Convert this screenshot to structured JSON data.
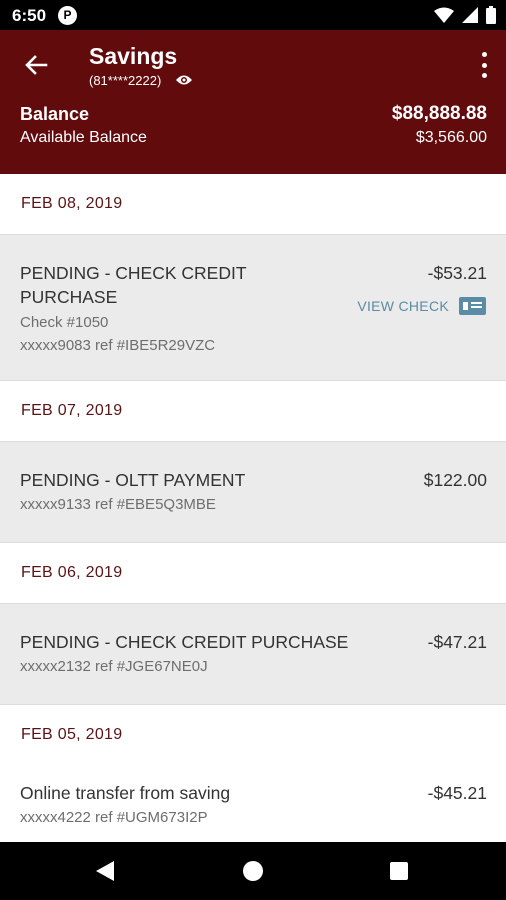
{
  "status_bar": {
    "time": "6:50",
    "app_badge": "P"
  },
  "header": {
    "title": "Savings",
    "account_number": "(81****2222)",
    "balance_label": "Balance",
    "balance_value": "$88,888.88",
    "available_label": "Available Balance",
    "available_value": "$3,566.00"
  },
  "groups": [
    {
      "date": "FEB 08, 2019",
      "transactions": [
        {
          "description_line1": "PENDING - CHECK CREDIT",
          "description_line2": "PURCHASE",
          "check": "Check #1050",
          "ref": "xxxxx9083 ref #IBE5R29VZC",
          "amount": "-$53.21",
          "action": "VIEW CHECK"
        }
      ]
    },
    {
      "date": "FEB 07, 2019",
      "transactions": [
        {
          "description": "PENDING - OLTT PAYMENT",
          "ref": "xxxxx9133 ref #EBE5Q3MBE",
          "amount": "$122.00"
        }
      ]
    },
    {
      "date": "FEB 06, 2019",
      "transactions": [
        {
          "description": "PENDING - CHECK CREDIT PURCHASE",
          "ref": "xxxxx2132 ref #JGE67NE0J",
          "amount": "-$47.21"
        }
      ]
    },
    {
      "date": "FEB 05, 2019",
      "transactions": [
        {
          "description": "Online transfer from saving",
          "ref": "xxxxx4222 ref #UGM673I2P",
          "amount": "-$45.21"
        }
      ]
    }
  ],
  "colors": {
    "header_bg": "#620b0d",
    "date_text": "#5a1416",
    "link": "#5b8ba6",
    "row_bg": "#ebebeb"
  },
  "icons": [
    "back-arrow-icon",
    "eye-icon",
    "more-vert-icon",
    "check-card-icon",
    "wifi-icon",
    "signal-icon",
    "battery-icon",
    "nav-back-icon",
    "nav-home-icon",
    "nav-recents-icon"
  ]
}
